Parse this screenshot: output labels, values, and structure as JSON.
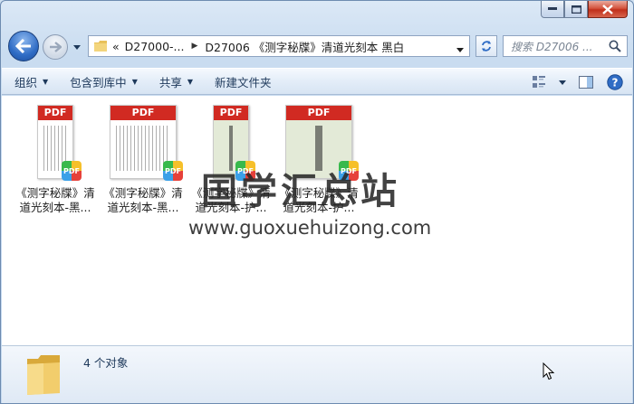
{
  "window": {
    "caption_buttons": [
      "minimize",
      "maximize",
      "close"
    ]
  },
  "nav": {
    "address_chevron": "«",
    "breadcrumbs": [
      "D27000-...",
      "D27006 《测字秘牒》清道光刻本 黑白"
    ],
    "search_placeholder": "搜索 D27006 ..."
  },
  "toolbar": {
    "organize": "组织",
    "include_in_library": "包含到库中",
    "share": "共享",
    "new_folder": "新建文件夹"
  },
  "files": [
    {
      "name": "《测字秘牒》清道光刻本-黑...",
      "badge": "PDF"
    },
    {
      "name": "《测字秘牒》清道光刻本-黑...",
      "badge": "PDF"
    },
    {
      "name": "《测字秘牒》清道光刻本-护...",
      "badge": "PDF"
    },
    {
      "name": "《测字秘牒》清道光刻本-护...",
      "badge": "PDF"
    }
  ],
  "watermark": {
    "title": "国学汇总站",
    "url": "www.guoxuehuizong.com"
  },
  "details": {
    "count_text": "4 个对象"
  },
  "colors": {
    "pdf_band": "#d12a22",
    "accent": "#2f6cc5"
  }
}
